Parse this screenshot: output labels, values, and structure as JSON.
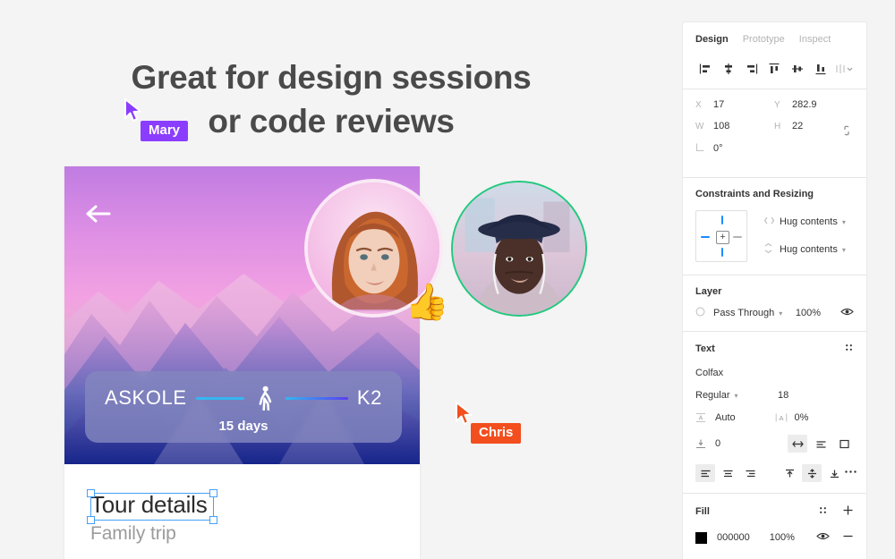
{
  "canvas": {
    "headline_line1": "Great for design sessions",
    "headline_line2": "or code reviews",
    "background_color": "#f4f4f4"
  },
  "collaborators": [
    {
      "name": "Mary",
      "color": "#8b3dff",
      "cursor_icon": "cursor-arrow-icon"
    },
    {
      "name": "Chris",
      "color": "#f24e1e",
      "cursor_icon": "cursor-arrow-icon"
    }
  ],
  "video_avatars": [
    {
      "person": "Mary",
      "ring_color": "#ffffff",
      "reaction": "👍",
      "description": "woman with curly auburn hair"
    },
    {
      "person": "Chris",
      "ring_color": "#22c97e",
      "reaction": "",
      "description": "man wearing navy fedora and earbuds"
    }
  ],
  "design_card": {
    "back_icon": "arrow-left-icon",
    "trek": {
      "origin": "ASKOLE",
      "destination": "K2",
      "duration": "15 days",
      "walk_icon": "walking-person-icon"
    },
    "title": "Tour details",
    "subtitle": "Family trip"
  },
  "panel": {
    "tabs": [
      {
        "label": "Design",
        "active": true
      },
      {
        "label": "Prototype",
        "active": false
      },
      {
        "label": "Inspect",
        "active": false
      }
    ],
    "align_tools": [
      {
        "name": "align-left-icon"
      },
      {
        "name": "align-horizontal-center-icon"
      },
      {
        "name": "align-right-icon"
      },
      {
        "name": "align-top-icon"
      },
      {
        "name": "align-vertical-center-icon"
      },
      {
        "name": "align-bottom-icon"
      },
      {
        "name": "distribute-dropdown-icon"
      }
    ],
    "transform": {
      "x_label": "X",
      "x_value": "17",
      "y_label": "Y",
      "y_value": "282.9",
      "w_label": "W",
      "w_value": "108",
      "h_label": "H",
      "h_value": "22",
      "angle_label": "angle-icon",
      "angle_value": "0°",
      "link_icon": "link-constrain-icon"
    },
    "constraints": {
      "title": "Constraints and Resizing",
      "horizontal": "Hug contents",
      "vertical": "Hug contents",
      "center_icon": "constraint-center-icon",
      "horizontal_icon": "resize-horizontal-icon",
      "vertical_icon": "resize-vertical-icon"
    },
    "layer": {
      "title": "Layer",
      "blend_mode": "Pass Through",
      "opacity": "100%",
      "blend_icon": "blend-mode-icon",
      "visibility_icon": "eye-icon"
    },
    "text": {
      "title": "Text",
      "settings_icon": "text-settings-icon",
      "font_family": "Colfax",
      "font_weight": "Regular",
      "font_size": "18",
      "line_height": "Auto",
      "line_height_icon": "line-height-icon",
      "letter_spacing": "0%",
      "letter_spacing_icon": "letter-spacing-icon",
      "paragraph_spacing": "0",
      "paragraph_spacing_icon": "paragraph-spacing-icon",
      "resize_icons": [
        "auto-width-icon",
        "auto-height-icon",
        "fixed-size-icon"
      ],
      "align_icons": [
        "text-align-left-icon",
        "text-align-center-icon",
        "text-align-right-icon"
      ],
      "valign_icons": [
        "text-align-top-icon",
        "text-align-middle-icon",
        "text-align-bottom-icon"
      ],
      "more_icon": "more-options-icon"
    },
    "fill": {
      "title": "Fill",
      "style_icon": "fill-style-icon",
      "add_icon": "plus-icon",
      "color_hex": "000000",
      "opacity": "100%",
      "visibility_icon": "eye-icon",
      "remove_icon": "minus-icon"
    }
  }
}
